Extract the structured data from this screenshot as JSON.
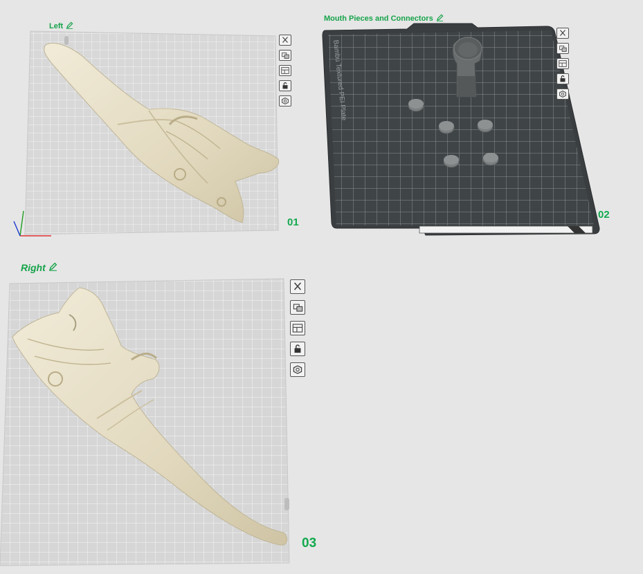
{
  "plates": [
    {
      "name": "Left",
      "number": "01",
      "surface": "smooth"
    },
    {
      "name": "Mouth Pieces and Connectors",
      "number": "02",
      "surface": "textured",
      "bed_text": "Bambu Textured PEI Plate"
    },
    {
      "name": "Right",
      "number": "03",
      "surface": "smooth"
    }
  ],
  "tools": [
    "close-icon",
    "arrange-icon",
    "orient-icon",
    "lock-icon",
    "settings-icon"
  ],
  "colors": {
    "label_green": "#16a34a",
    "model": "#e4dcc4",
    "plate_grid": "#d6d6d6",
    "textured_plate": "#3f4447"
  }
}
